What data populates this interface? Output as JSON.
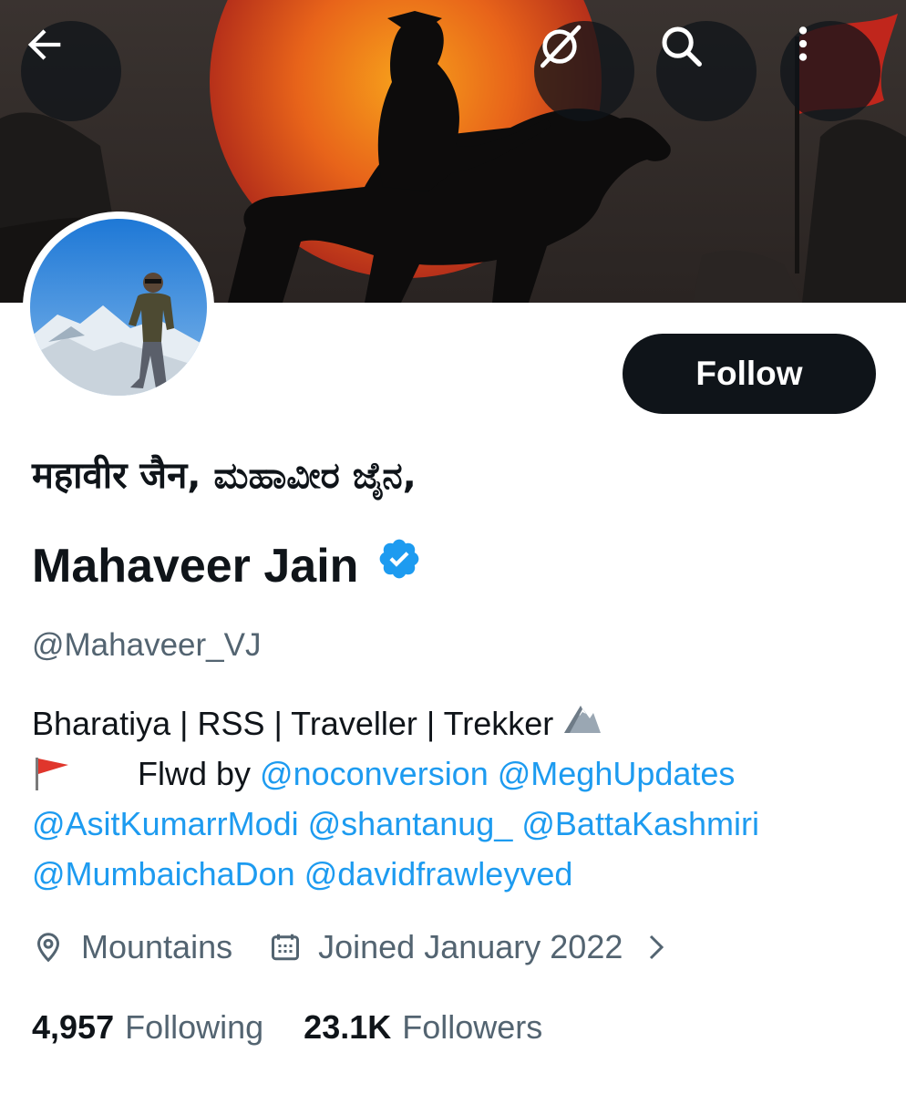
{
  "header": {
    "back_icon": "arrow-left-icon",
    "grok_icon": "grok-icon",
    "search_icon": "search-icon",
    "more_icon": "more-vertical-icon"
  },
  "profile": {
    "follow_label": "Follow",
    "name_line1": "महावीर जैन, ಮಹಾವೀರ ಜೈನ,",
    "name_line2": "Mahaveer Jain",
    "verified": true,
    "handle": "@Mahaveer_VJ",
    "bio": {
      "line1": "Bharatiya | RSS | Traveller | Trekker",
      "flwd_by": "Flwd by",
      "mentions": [
        "@noconversion",
        "@MeghUpdates",
        "@AsitKumarrModi",
        "@shantanug_",
        "@BattaKashmiri",
        "@MumbaichaDon",
        "@davidfrawleyved"
      ]
    },
    "location": "Mountains",
    "joined": "Joined January 2022",
    "following_count": "4,957",
    "following_label": "Following",
    "followers_count": "23.1K",
    "followers_label": "Followers"
  },
  "colors": {
    "link": "#1d9bf0",
    "text": "#0f1419",
    "muted": "#536471",
    "button": "#0f1419"
  }
}
